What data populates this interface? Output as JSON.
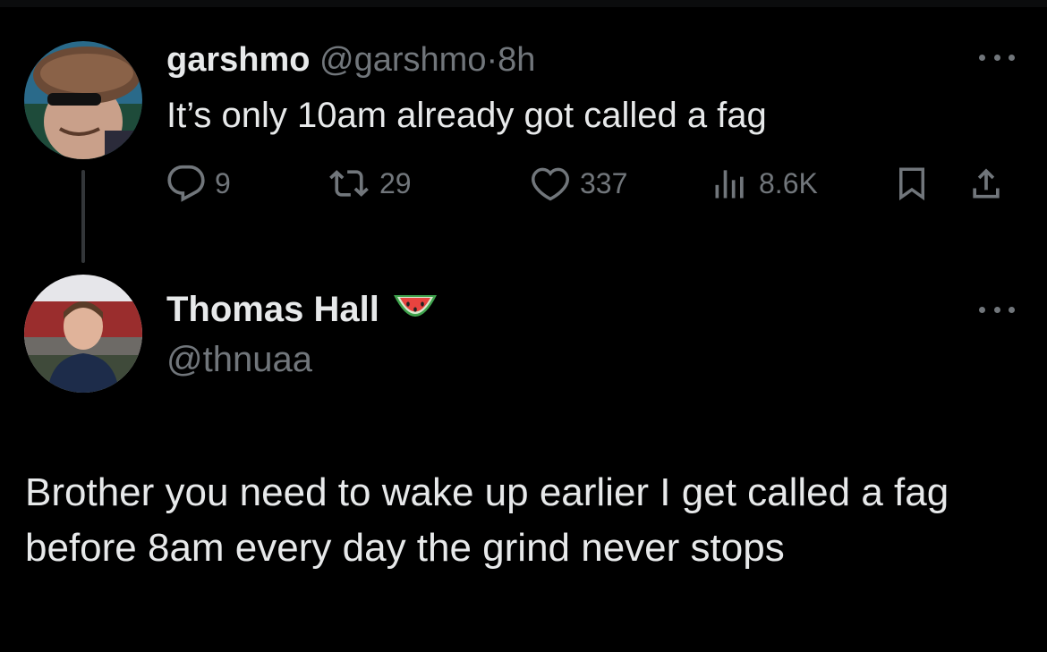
{
  "tweet1": {
    "display_name": "garshmo",
    "handle": "@garshmo",
    "separator": "·",
    "time": "8h",
    "text": "It’s only 10am already got called a fag",
    "actions": {
      "reply_count": "9",
      "retweet_count": "29",
      "like_count": "337",
      "views_count": "8.6K"
    }
  },
  "tweet2": {
    "display_name": "Thomas Hall",
    "handle": "@thnuaa",
    "text": "Brother you need to wake up earlier I get called a fag before 8am every day the grind never stops"
  },
  "icons": {
    "reply": "reply-icon",
    "retweet": "retweet-icon",
    "like": "heart-icon",
    "views": "views-icon",
    "bookmark": "bookmark-icon",
    "share": "share-icon",
    "more": "more-icon",
    "name_emoji": "watermelon-icon"
  },
  "colors": {
    "background": "#000000",
    "text_primary": "#e7e9ea",
    "text_secondary": "#71767b",
    "thread_line": "#333639"
  }
}
